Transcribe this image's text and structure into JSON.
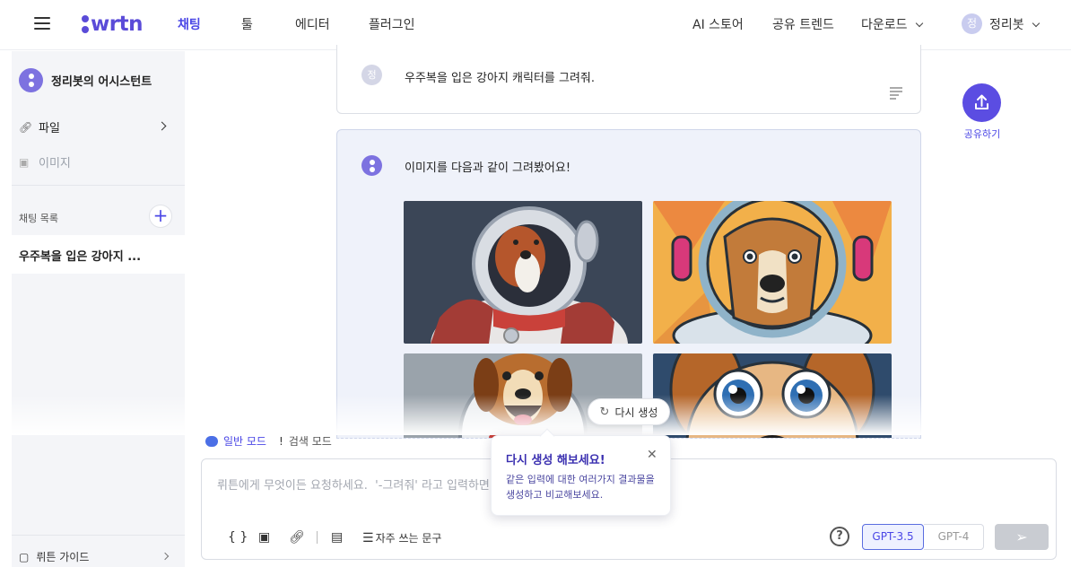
{
  "header": {
    "logo": "wrtn",
    "nav": [
      "채팅",
      "툴",
      "에디터",
      "플러그인"
    ],
    "right": {
      "store": "AI 스토어",
      "trend": "공유 트렌드",
      "download": "다운로드",
      "user_initial": "정",
      "user_name": "정리봇"
    }
  },
  "sidebar": {
    "assistant": "정리봇의 어시스턴트",
    "file": "파일",
    "image": "이미지",
    "chat_list_label": "채팅 목록",
    "chat_item": "우주복을 입은 강아지 ...",
    "guide": "뤼튼 가이드"
  },
  "conversation": {
    "user_initial": "정",
    "user_message": "우주복을 입은 강아지 캐릭터를 그려줘.",
    "bot_message": "이미지를 다음과 같이 그려봤어요!",
    "regenerate": "다시 생성"
  },
  "share": {
    "label": "공유하기"
  },
  "modes": {
    "general": "일반 모드",
    "search": "검색 모드"
  },
  "input": {
    "placeholder": "뤼튼에게 무엇이든 요청하세요.  '-그려줘' 라고 입력하면 뤼",
    "phrases": "자주 쓰는 문구",
    "models": [
      "GPT-3.5",
      "GPT-4"
    ]
  },
  "tooltip": {
    "title": "다시 생성 해보세요!",
    "body": "같은 입력에 대한 여러가지 결과물을 생성하고 비교해보세요."
  },
  "colors": {
    "accent": "#4b47e6",
    "brand": "#5a4bd8",
    "share": "#5b4de2"
  }
}
